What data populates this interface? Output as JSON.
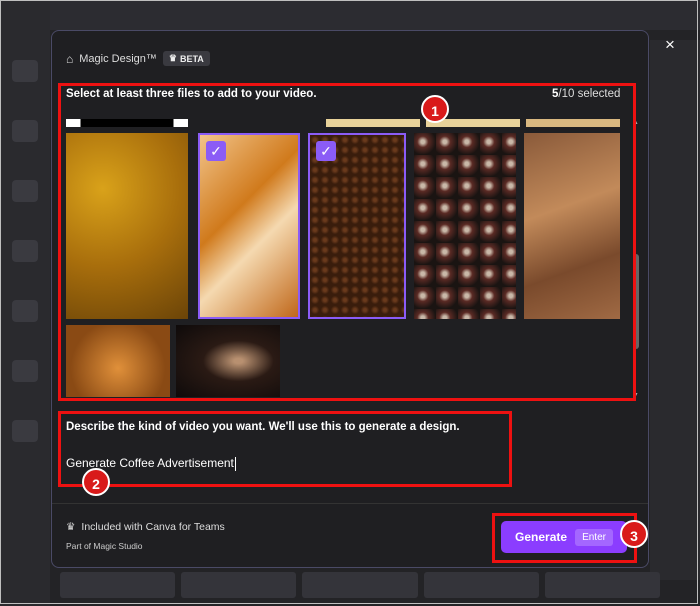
{
  "header": {
    "title": "Magic Design™",
    "beta": "BETA"
  },
  "close_label": "×",
  "files": {
    "instruction": "Select at least three files to add to your video.",
    "selected_count": "5",
    "selected_total": "/10 selected",
    "check": "✓",
    "scroll_up": "▲",
    "scroll_down": "▼"
  },
  "prompt": {
    "label": "Describe the kind of video you want. We'll use this to generate a design.",
    "value": "Generate Coffee Advertisement"
  },
  "footer": {
    "included": "Included with Canva for Teams",
    "part_of": "Part of Magic Studio",
    "generate": "Generate",
    "enter": "Enter"
  },
  "annotations": [
    "1",
    "2",
    "3"
  ]
}
